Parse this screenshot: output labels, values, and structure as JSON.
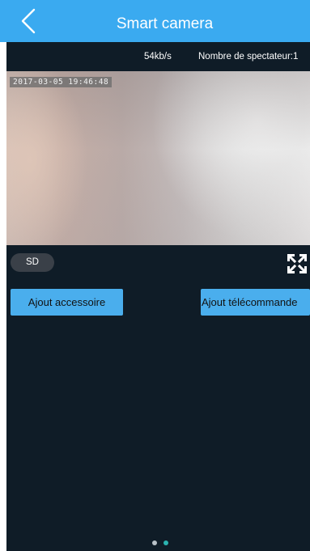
{
  "header": {
    "title": "Smart camera",
    "back_icon": "chevron-left-icon"
  },
  "stats": {
    "bitrate": "54kb/s",
    "viewers": "Nombre de spectateur:1"
  },
  "video": {
    "timestamp": "2017-03-05 19:46:48"
  },
  "controls": {
    "quality_label": "SD",
    "fullscreen_icon": "fullscreen-expand-icon"
  },
  "actions": {
    "add_accessory": "Ajout accessoire",
    "add_remote": "Ajout télécommande"
  },
  "pager": {
    "page_count": 2,
    "active_page": 2
  },
  "colors": {
    "accent": "#3aaaf0",
    "background": "#0f1c27",
    "button": "#4aaeed",
    "active_dot": "#2bb3b0"
  }
}
